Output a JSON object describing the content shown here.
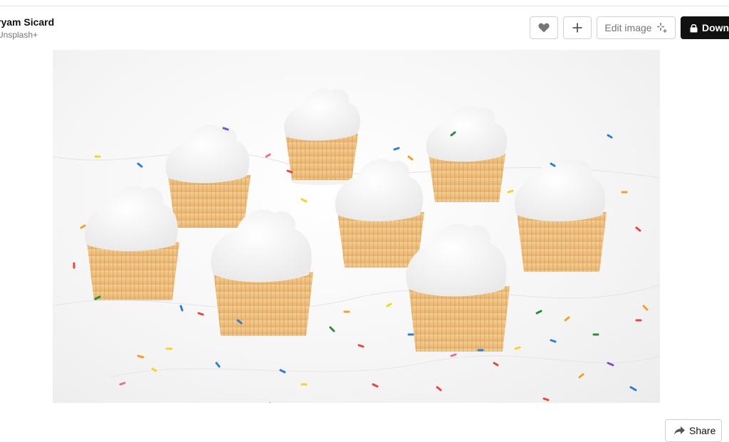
{
  "author": {
    "name": "ryam Sicard",
    "subtitle": "Unsplash+"
  },
  "toolbar": {
    "like_icon": "heart-icon",
    "add_icon": "plus-icon",
    "edit_label": "Edit image",
    "edit_icon": "sparkle-icon",
    "download_label": "Down",
    "download_icon": "lock-icon"
  },
  "footer": {
    "share_label": "Share",
    "share_icon": "share-arrow-icon"
  },
  "colors": {
    "download_bg": "#111111",
    "border": "#d1d1d1",
    "muted_text": "#767676"
  }
}
